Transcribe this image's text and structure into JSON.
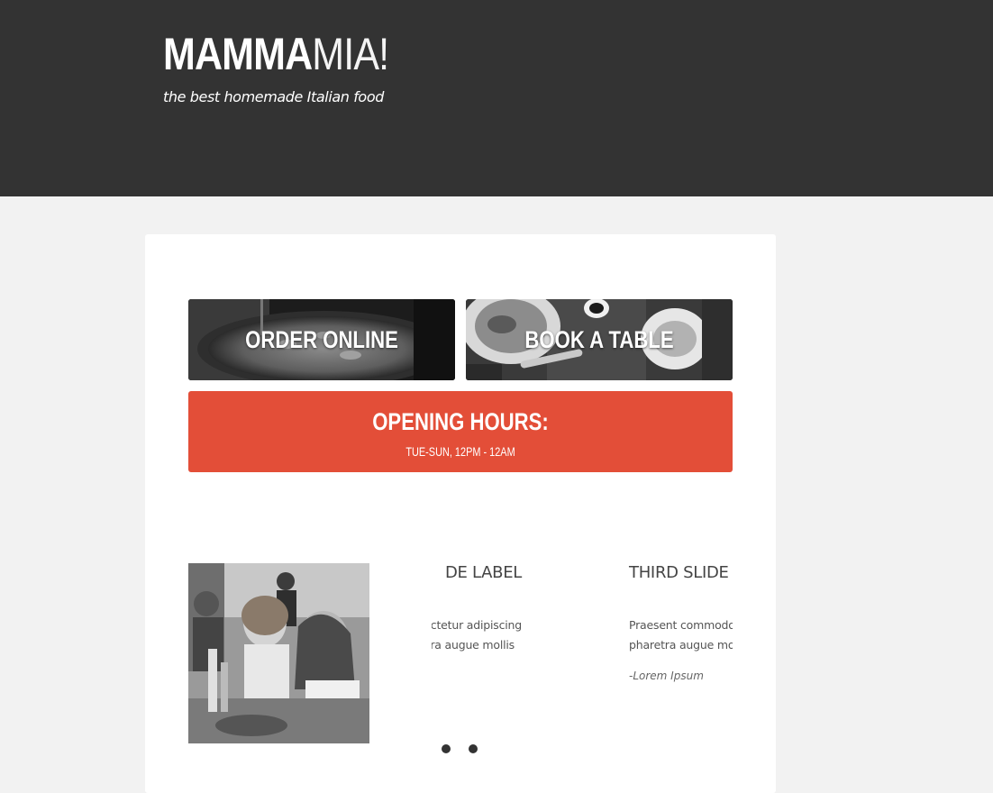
{
  "header": {
    "logo_bold": "MAMMA",
    "logo_light": "MIA!",
    "tagline": "the best homemade Italian food",
    "background": "#333333"
  },
  "actions": {
    "order_online": "ORDER ONLINE",
    "book_table": "BOOK A TABLE"
  },
  "hours": {
    "title": "OPENING HOURS:",
    "time": "TUE-SUN, 12PM - 12AM",
    "background": "#e34e38"
  },
  "slider": {
    "slides": [
      {
        "label": "DE LABEL",
        "lines": [
          "sit amet, consectetur adipiscing",
          "libero, a pharetra augue mollis"
        ]
      },
      {
        "label": "THIRD SLIDE",
        "lines": [
          "Praesent commodo",
          "pharetra augue mo"
        ],
        "author": "-Lorem Ipsum"
      }
    ],
    "dot_count": 2
  },
  "icons": {
    "order_tile": "pizza-photo",
    "book_tile": "table-food-photo",
    "testimonial": "diners-photo"
  }
}
